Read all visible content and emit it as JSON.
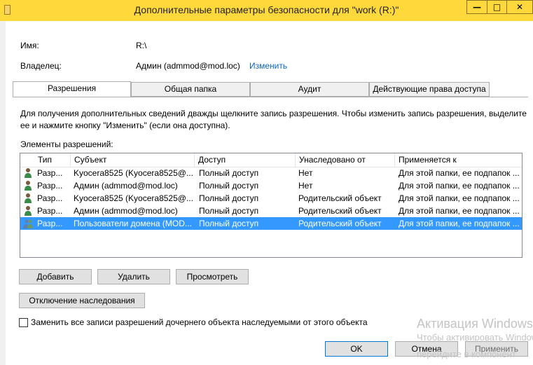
{
  "window": {
    "title": "Дополнительные параметры безопасности  для \"work (R:)\"",
    "minimize_glyph": "—",
    "maximize_glyph": "□",
    "close_glyph": "✕"
  },
  "info": {
    "name_label": "Имя:",
    "name_value": "R:\\",
    "owner_label": "Владелец:",
    "owner_value": "Админ (admmod@mod.loc)",
    "change_link": "Изменить"
  },
  "tabs": [
    {
      "label": "Разрешения",
      "active": true
    },
    {
      "label": "Общая папка",
      "active": false
    },
    {
      "label": "Аудит",
      "active": false
    },
    {
      "label": "Действующие права доступа",
      "active": false
    }
  ],
  "description": {
    "line1": "Для получения дополнительных сведений дважды щелкните запись разрешения. Чтобы изменить запись разрешения, выделите",
    "line2": "ее и нажмите кнопку \"Изменить\" (если она доступна)."
  },
  "permissions": {
    "label": "Элементы разрешений:",
    "columns": [
      "Тип",
      "Субъект",
      "Доступ",
      "Унаследовано от",
      "Применяется к"
    ],
    "rows": [
      {
        "type": "Разр...",
        "subject": "Kyocera8525 (Kyocera8525@...",
        "access": "Полный доступ",
        "inherited": "Нет",
        "applies": "Для этой папки, ее подпапок ...",
        "icon": "user-icon",
        "selected": false
      },
      {
        "type": "Разр...",
        "subject": "Админ (admmod@mod.loc)",
        "access": "Полный доступ",
        "inherited": "Нет",
        "applies": "Для этой папки, ее подпапок ...",
        "icon": "user-icon",
        "selected": false
      },
      {
        "type": "Разр...",
        "subject": "Kyocera8525 (Kyocera8525@...",
        "access": "Полный доступ",
        "inherited": "Родительский объект",
        "applies": "Для этой папки, ее подпапок ...",
        "icon": "user-icon",
        "selected": false
      },
      {
        "type": "Разр...",
        "subject": "Админ (admmod@mod.loc)",
        "access": "Полный доступ",
        "inherited": "Родительский объект",
        "applies": "Для этой папки, ее подпапок ...",
        "icon": "user-icon",
        "selected": false
      },
      {
        "type": "Разр...",
        "subject": "Пользователи домена (MOD...",
        "access": "Полный доступ",
        "inherited": "Родительский объект",
        "applies": "Для этой папки, ее подпапок ...",
        "icon": "group-icon",
        "selected": true
      }
    ]
  },
  "buttons": {
    "add": "Добавить",
    "remove": "Удалить",
    "view": "Просмотреть",
    "disable_inheritance": "Отключение наследования",
    "ok": "OK",
    "cancel": "Отмена",
    "apply": "Применить"
  },
  "replace_checkbox": {
    "label": "Заменить все записи разрешений дочернего объекта наследуемыми от этого объекта",
    "checked": false
  },
  "watermark": {
    "line1": "Активация Windows",
    "line2": "Чтобы активировать Windows,",
    "line3": "перейдите в компонент"
  },
  "colors": {
    "titlebar": "#ffd83b",
    "selection": "#3399ff",
    "link": "#0b64c8"
  }
}
